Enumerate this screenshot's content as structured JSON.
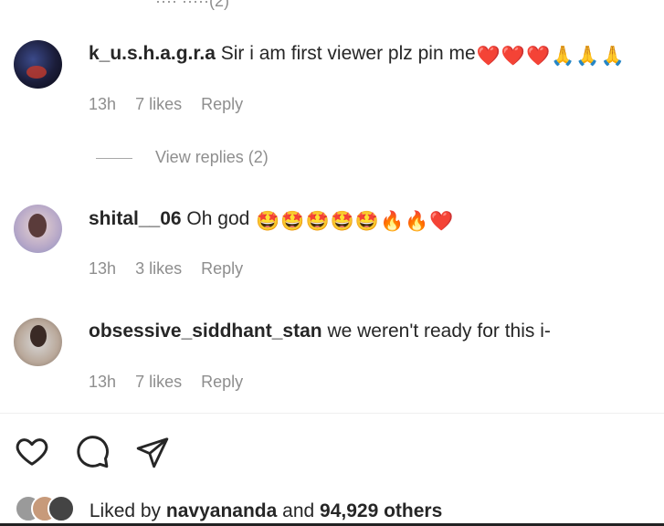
{
  "top_partial": "···· ·····(2)",
  "comments": [
    {
      "username": "k_u.s.h.a.g.r.a",
      "text": "Sir i am first viewer plz pin me",
      "emojis": [
        "❤️",
        "❤️",
        "❤️",
        "🙏",
        "🙏",
        "🙏"
      ],
      "time": "13h",
      "likes": "7 likes",
      "reply": "Reply",
      "view_replies": "View replies (2)"
    },
    {
      "username": "shital__06",
      "text": "Oh god",
      "emojis": [
        "🤩",
        "🤩",
        "🤩",
        "🤩",
        "🤩",
        "🔥",
        "🔥",
        "❤️"
      ],
      "time": "13h",
      "likes": "3 likes",
      "reply": "Reply"
    },
    {
      "username": "obsessive_siddhant_stan",
      "text": "we weren't ready for this i-",
      "time": "13h",
      "likes": "7 likes",
      "reply": "Reply"
    }
  ],
  "actions": {
    "like_icon": "heart-icon",
    "comment_icon": "comment-icon",
    "share_icon": "send-icon"
  },
  "liked_by": {
    "prefix": "Liked by",
    "user": "navyananda",
    "conjunction": "and",
    "count": "94,929 others"
  }
}
